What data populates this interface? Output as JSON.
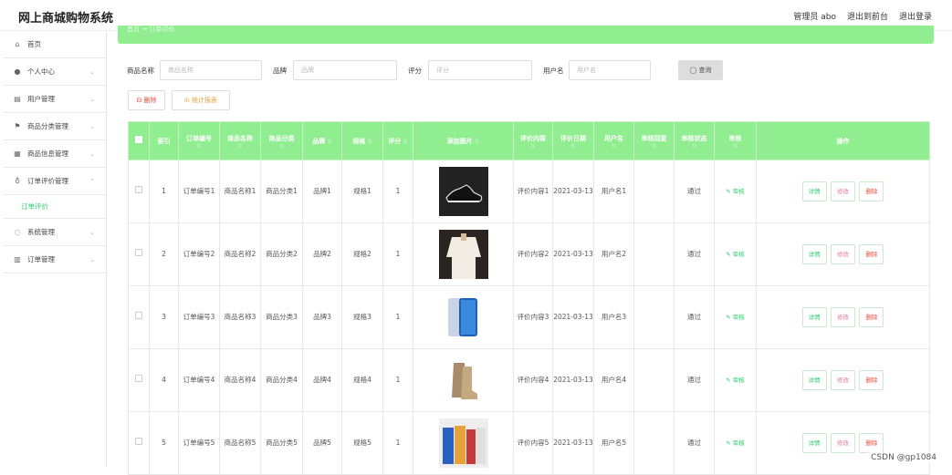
{
  "header": {
    "title": "网上商城购物系统",
    "admin": "管理员 abo",
    "exit_front": "退出到前台",
    "logout": "退出登录"
  },
  "sidebar": {
    "items": [
      {
        "label": "首页",
        "icon": "home-icon",
        "chev": ""
      },
      {
        "label": "个人中心",
        "icon": "user-icon",
        "chev": "⌄"
      },
      {
        "label": "用户管理",
        "icon": "users-icon",
        "chev": "⌄"
      },
      {
        "label": "商品分类管理",
        "icon": "flag-icon",
        "chev": "⌄"
      },
      {
        "label": "商品信息管理",
        "icon": "list-icon",
        "chev": "⌄"
      },
      {
        "label": "订单评价管理",
        "icon": "mic-icon",
        "chev": "⌃"
      }
    ],
    "sub_item": "订单评价",
    "items2": [
      {
        "label": "系统管理",
        "icon": "settings-icon",
        "chev": "⌄"
      },
      {
        "label": "订单管理",
        "icon": "order-icon",
        "chev": "⌄"
      }
    ]
  },
  "breadcrumb": "首页 → 订单评价",
  "search": {
    "name_label": "商品名称",
    "name_ph": "商品名称",
    "brand_label": "品牌",
    "brand_ph": "品牌",
    "score_label": "评分",
    "score_ph": "评分",
    "user_label": "用户名",
    "user_ph": "用户名",
    "query": "◯ 查询"
  },
  "actions": {
    "delete": "⊟ 删除",
    "stats": "ılı 统计报表"
  },
  "table": {
    "headers": [
      "索引",
      "订单编号",
      "商品名称",
      "商品分类",
      "品牌",
      "规格",
      "评分",
      "添加图片",
      "评价内容",
      "评价日期",
      "用户名",
      "审核回复",
      "审核状态",
      "审核",
      "操作"
    ],
    "sort_mark": "⇅",
    "audit_label": "✎ 审核",
    "ops": {
      "detail": "详情",
      "edit": "修改",
      "remove": "删除"
    },
    "rows": [
      {
        "idx": "1",
        "order": "订单编号1",
        "name": "商品名称1",
        "cat": "商品分类1",
        "brand": "品牌1",
        "spec": "规格1",
        "score": "1",
        "img": "sneaker",
        "content": "评价内容1",
        "date": "2021-03-13",
        "user": "用户名1",
        "reply": "",
        "status": "通过"
      },
      {
        "idx": "2",
        "order": "订单编号2",
        "name": "商品名称2",
        "cat": "商品分类2",
        "brand": "品牌2",
        "spec": "规格2",
        "score": "1",
        "img": "blouse",
        "content": "评价内容2",
        "date": "2021-03-13",
        "user": "用户名2",
        "reply": "",
        "status": "通过"
      },
      {
        "idx": "3",
        "order": "订单编号3",
        "name": "商品名称3",
        "cat": "商品分类3",
        "brand": "品牌3",
        "spec": "规格3",
        "score": "1",
        "img": "phone",
        "content": "评价内容3",
        "date": "2021-03-13",
        "user": "用户名3",
        "reply": "",
        "status": "通过"
      },
      {
        "idx": "4",
        "order": "订单编号4",
        "name": "商品名称4",
        "cat": "商品分类4",
        "brand": "品牌4",
        "spec": "规格4",
        "score": "1",
        "img": "boots",
        "content": "评价内容4",
        "date": "2021-03-13",
        "user": "用户名4",
        "reply": "",
        "status": "通过"
      },
      {
        "idx": "5",
        "order": "订单编号5",
        "name": "商品名称5",
        "cat": "商品分类5",
        "brand": "品牌5",
        "spec": "规格5",
        "score": "1",
        "img": "cartons",
        "content": "评价内容5",
        "date": "2021-03-13",
        "user": "用户名5",
        "reply": "",
        "status": "通过"
      }
    ]
  },
  "watermark": "CSDN @gp1084",
  "colors": {
    "accent": "#90ee90",
    "green_text": "#2ecc71",
    "danger": "#e74c3c"
  }
}
